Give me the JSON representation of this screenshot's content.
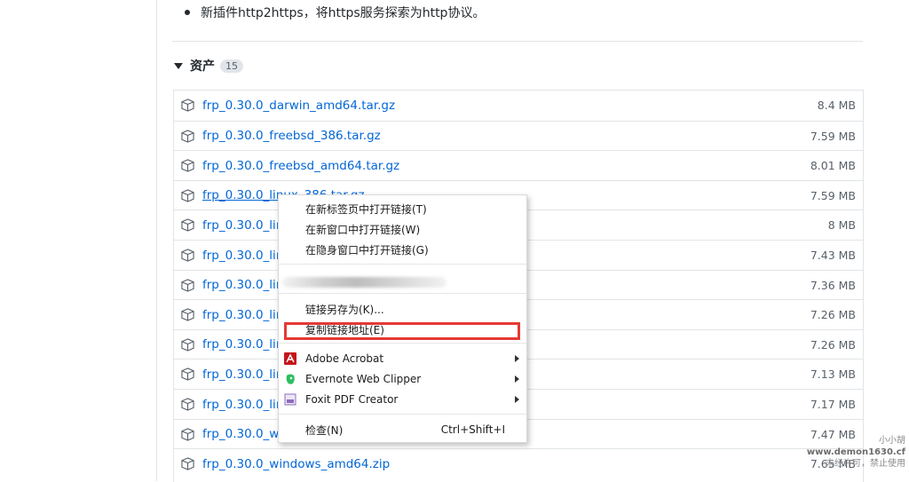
{
  "release_note": "新插件http2https，将https服务探索为http协议。",
  "assets": {
    "heading": "资产",
    "count": "15",
    "items": [
      {
        "name": "frp_0.30.0_darwin_amd64.tar.gz",
        "size": "8.4 MB"
      },
      {
        "name": "frp_0.30.0_freebsd_386.tar.gz",
        "size": "7.59 MB"
      },
      {
        "name": "frp_0.30.0_freebsd_amd64.tar.gz",
        "size": "8.01 MB"
      },
      {
        "name": "frp_0.30.0_linux_386.tar.gz",
        "size": "7.59 MB"
      },
      {
        "name": "frp_0.30.0_lin",
        "size": "8 MB"
      },
      {
        "name": "frp_0.30.0_lin",
        "size": "7.43 MB"
      },
      {
        "name": "frp_0.30.0_lin",
        "size": "7.36 MB"
      },
      {
        "name": "frp_0.30.0_lin",
        "size": "7.26 MB"
      },
      {
        "name": "frp_0.30.0_lin",
        "size": "7.26 MB"
      },
      {
        "name": "frp_0.30.0_lin",
        "size": "7.13 MB"
      },
      {
        "name": "frp_0.30.0_lin",
        "size": "7.17 MB"
      },
      {
        "name": "frp_0.30.0_wir",
        "size": "7.47 MB"
      },
      {
        "name": "frp_0.30.0_windows_amd64.zip",
        "size": "7.65 MB"
      }
    ]
  },
  "context_menu": {
    "open_new_tab": "在新标签页中打开链接(T)",
    "open_new_window": "在新窗口中打开链接(W)",
    "open_incognito": "在隐身窗口中打开链接(G)",
    "save_link_as": "链接另存为(K)...",
    "copy_link_address": "复制链接地址(E)",
    "adobe_acrobat": "Adobe Acrobat",
    "evernote": "Evernote Web Clipper",
    "foxit": "Foxit PDF Creator",
    "inspect": "检查(N)",
    "inspect_shortcut": "Ctrl+Shift+I"
  },
  "colors": {
    "link": "#0366d6",
    "highlight": "#e53935",
    "acrobat": "#c4161c",
    "evernote": "#2dbe60",
    "foxit": "#8e6bbf"
  },
  "icons": {
    "asset": "package-icon",
    "caret": "triangle-down-icon",
    "submenu": "chevron-right-icon"
  },
  "watermark": {
    "line1": "小小胡",
    "line2": "www.demon1630.cf",
    "line3": "未经许可，禁止使用"
  }
}
